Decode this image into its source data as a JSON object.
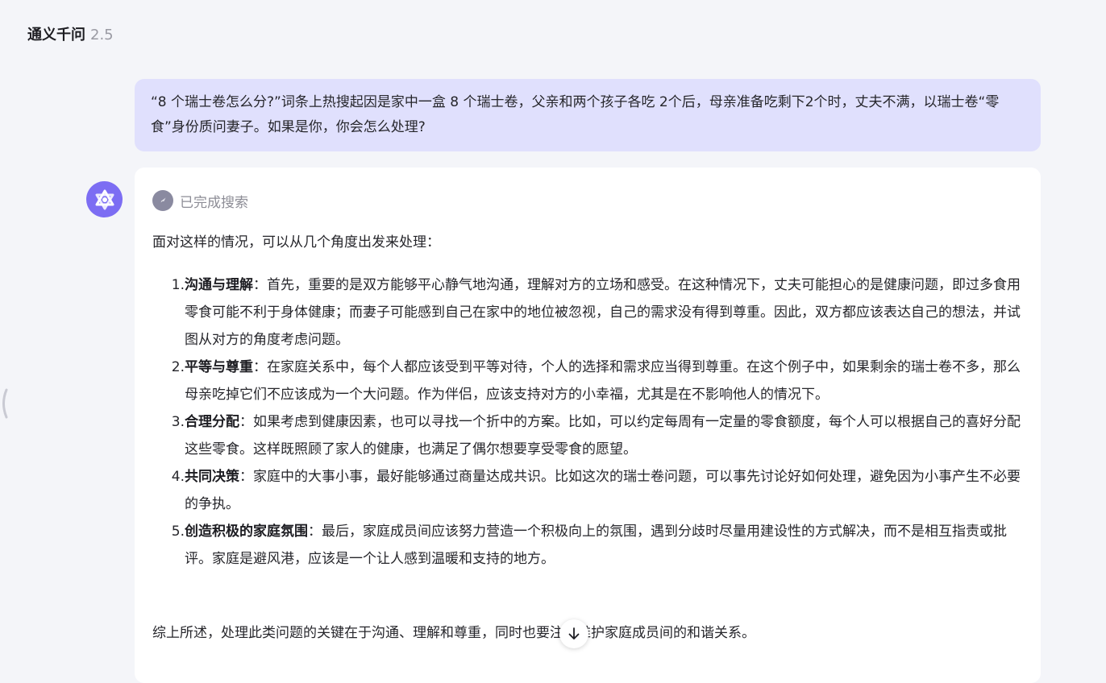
{
  "header": {
    "app_name": "通义千问",
    "version": "2.5"
  },
  "user_message": {
    "text": "“8 个瑞士卷怎么分?”词条上热搜起因是家中一盒 8 个瑞士卷，父亲和两个孩子各吃 2个后，母亲准备吃剩下2个时，丈夫不满，以瑞士卷“零食”身份质问妻子。如果是你，你会怎么处理?"
  },
  "assistant": {
    "search_status": "已完成搜索",
    "intro": "面对这样的情况，可以从几个角度出发来处理：",
    "points": [
      {
        "num": "1.",
        "title": "沟通与理解",
        "body": "：首先，重要的是双方能够平心静气地沟通，理解对方的立场和感受。在这种情况下，丈夫可能担心的是健康问题，即过多食用零食可能不利于身体健康；而妻子可能感到自己在家中的地位被忽视，自己的需求没有得到尊重。因此，双方都应该表达自己的想法，并试图从对方的角度考虑问题。"
      },
      {
        "num": "2.",
        "title": "平等与尊重",
        "body": "：在家庭关系中，每个人都应该受到平等对待，个人的选择和需求应当得到尊重。在这个例子中，如果剩余的瑞士卷不多，那么母亲吃掉它们不应该成为一个大问题。作为伴侣，应该支持对方的小幸福，尤其是在不影响他人的情况下。"
      },
      {
        "num": "3.",
        "title": "合理分配",
        "body": "：如果考虑到健康因素，也可以寻找一个折中的方案。比如，可以约定每周有一定量的零食额度，每个人可以根据自己的喜好分配这些零食。这样既照顾了家人的健康，也满足了偶尔想要享受零食的愿望。"
      },
      {
        "num": "4.",
        "title": "共同决策",
        "body": "：家庭中的大事小事，最好能够通过商量达成共识。比如这次的瑞士卷问题，可以事先讨论好如何处理，避免因为小事产生不必要的争执。"
      },
      {
        "num": "5.",
        "title": "创造积极的家庭氛围",
        "body": "：最后，家庭成员间应该努力营造一个积极向上的氛围，遇到分歧时尽量用建设性的方式解决，而不是相互指责或批评。家庭是避风港，应该是一个让人感到温暖和支持的地方。"
      }
    ],
    "summary": "综上所述，处理此类问题的关键在于沟通、理解和尊重，同时也要注重维护家庭成员间的和谐关系。"
  },
  "icons": {
    "avatar": "tongyi-logo-icon",
    "search_status": "compass-icon",
    "scroll": "arrow-down-icon",
    "side": "chevron-left-icon"
  },
  "colors": {
    "page_bg": "#f4f5f9",
    "user_bubble": "#e0e0fd",
    "avatar": "#7c6df3",
    "card": "#ffffff"
  }
}
